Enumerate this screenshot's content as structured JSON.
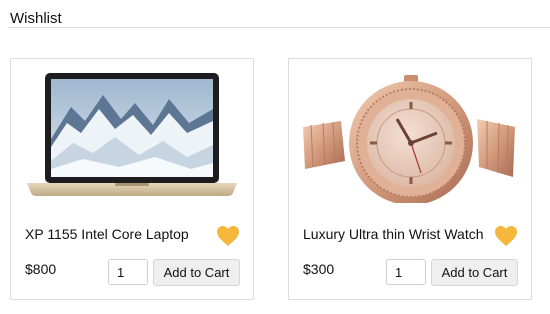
{
  "page": {
    "title": "Wishlist"
  },
  "colors": {
    "heart": "#f5b73b",
    "border": "#dedede",
    "button_bg": "#efefef"
  },
  "products": [
    {
      "name": "XP 1155 Intel Core Laptop",
      "price": "$800",
      "quantity": "1",
      "add_to_cart_label": "Add to Cart",
      "image_icon": "laptop-image",
      "favorite_icon": "heart-icon"
    },
    {
      "name": "Luxury Ultra thin Wrist Watch",
      "price": "$300",
      "quantity": "1",
      "add_to_cart_label": "Add to Cart",
      "image_icon": "watch-image",
      "favorite_icon": "heart-icon"
    }
  ]
}
